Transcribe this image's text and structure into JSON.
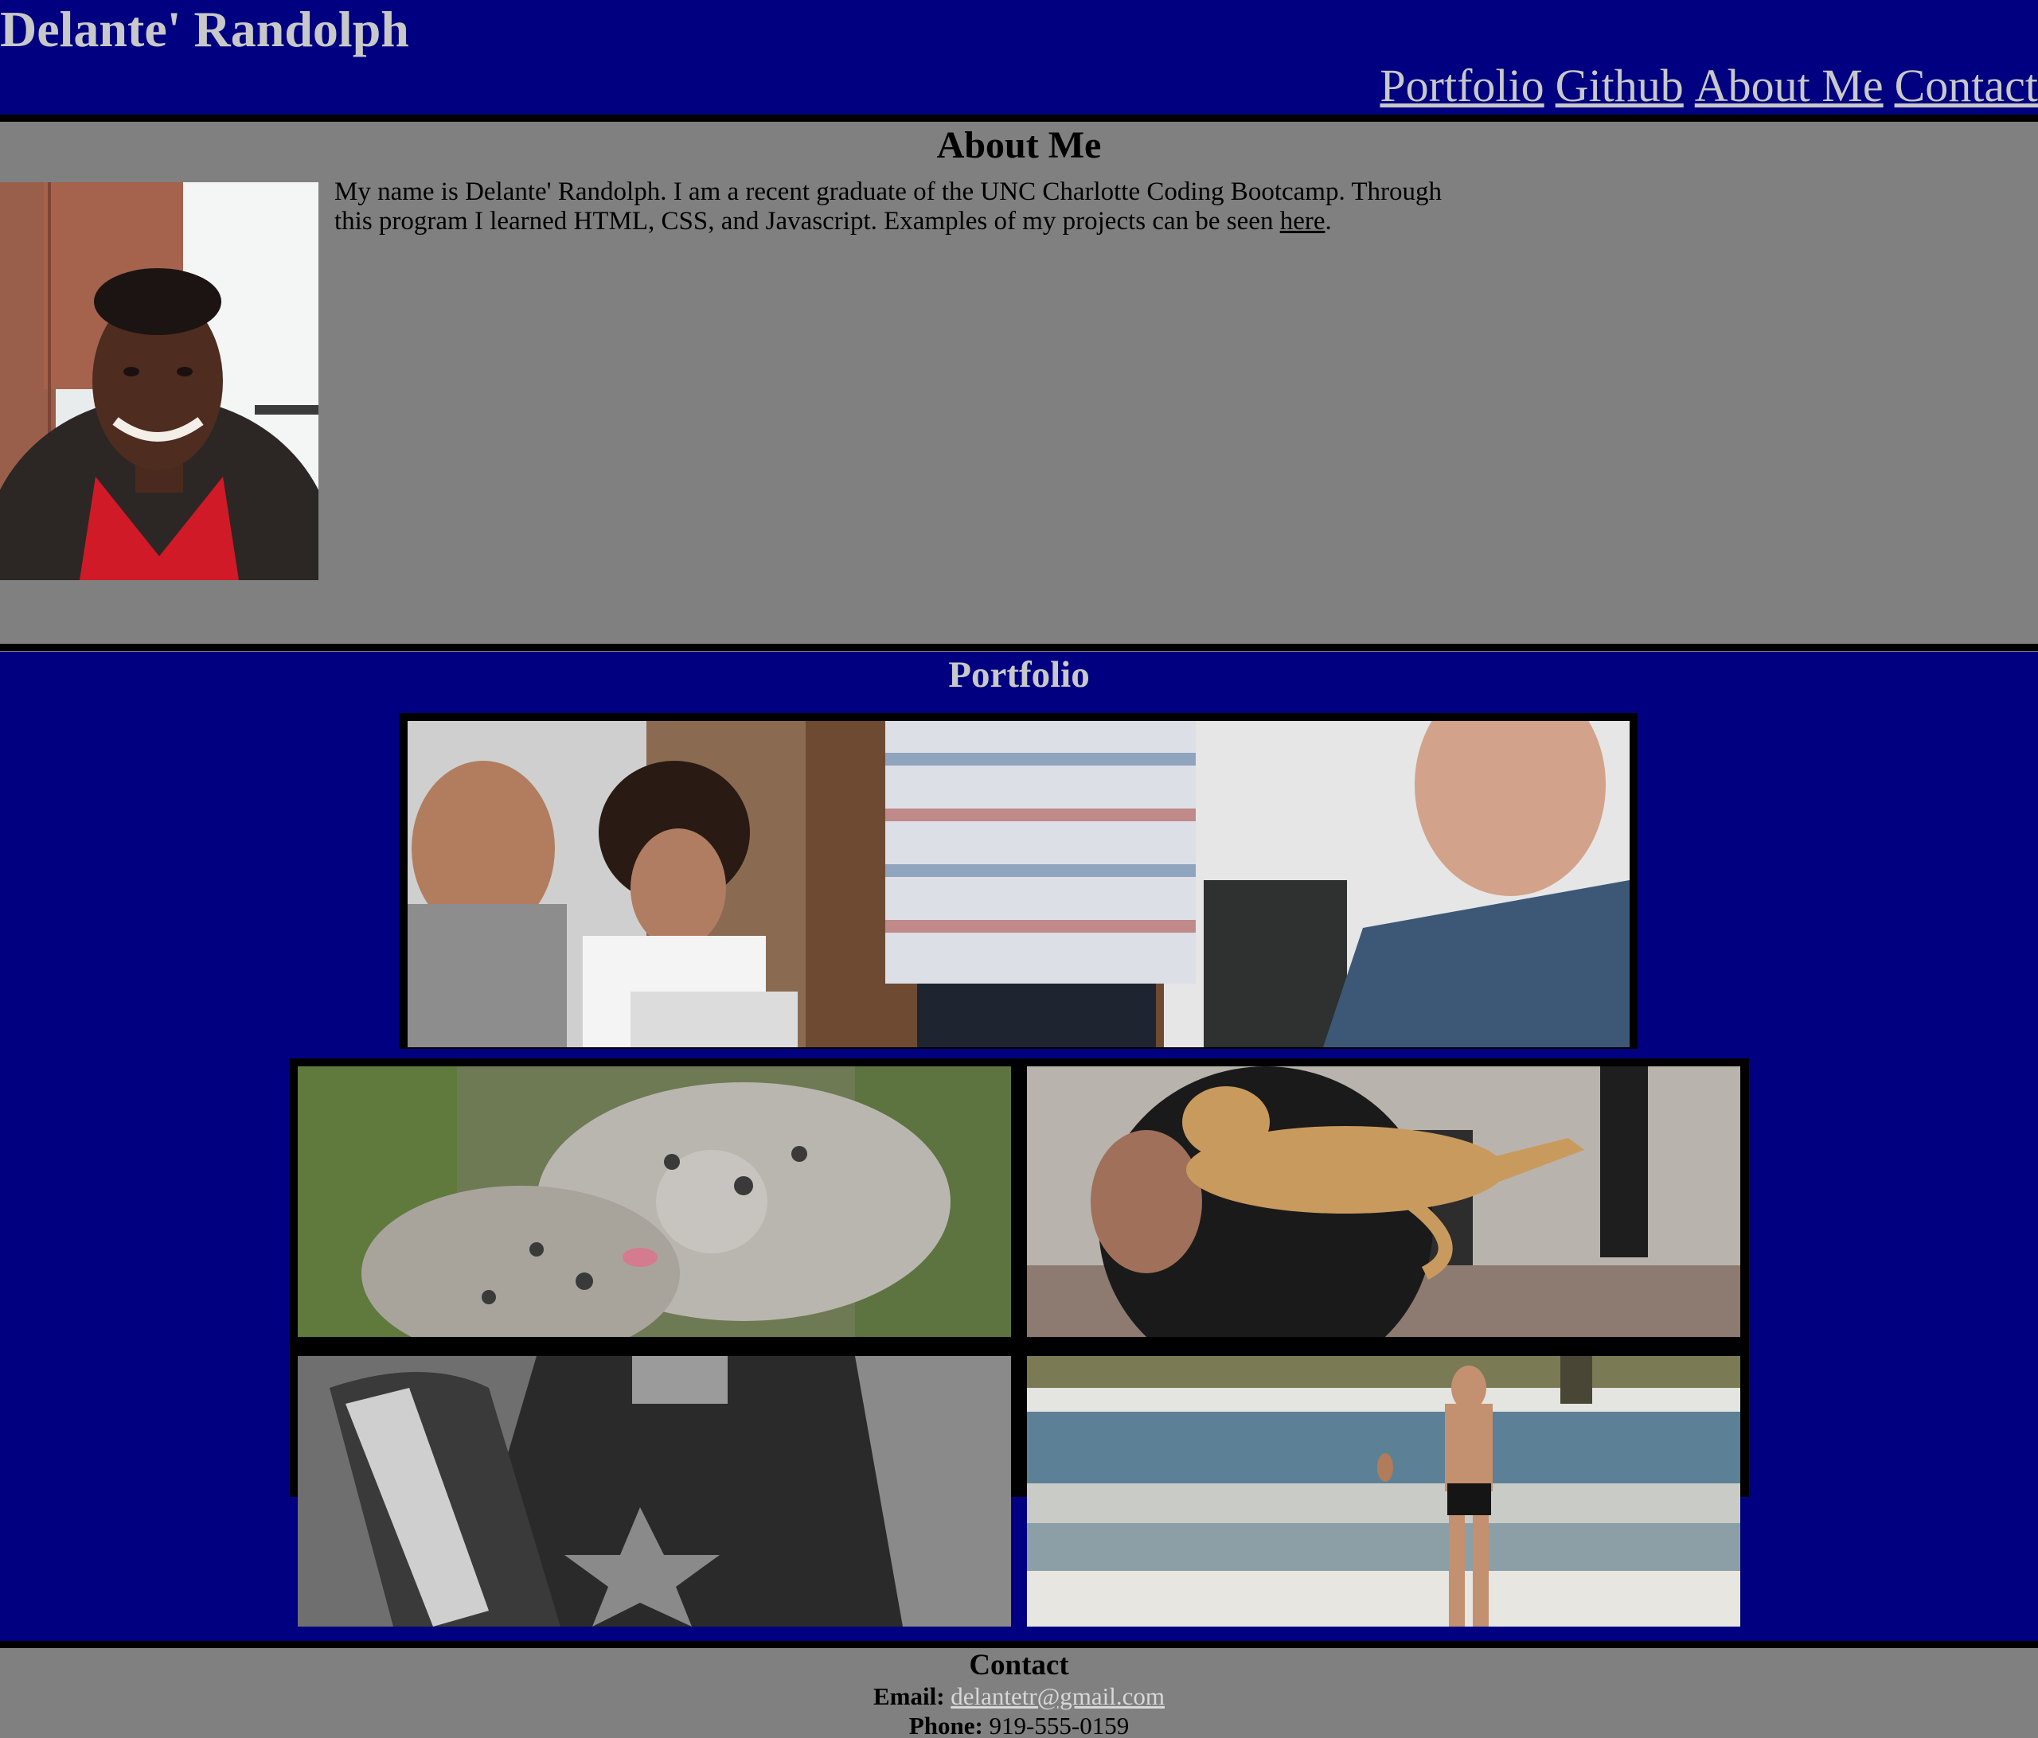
{
  "header": {
    "title": "Delante' Randolph",
    "nav": [
      "Portfolio",
      "Github",
      "About Me",
      "Contact"
    ]
  },
  "about": {
    "heading": "About Me",
    "text_before_link": "My name is Delante' Randolph. I am a recent graduate of the UNC Charlotte Coding Bootcamp. Through this program I learned HTML, CSS, and Javascript. Examples of my projects can be seen ",
    "link_text": "here",
    "text_after_link": "."
  },
  "portfolio": {
    "heading": "Portfolio"
  },
  "contact": {
    "heading": "Contact",
    "email_label": "Email:",
    "email": "delantetr@gmail.com",
    "phone_label": "Phone:",
    "phone": "919-555-0159"
  },
  "colors": {
    "navy": "#000080",
    "gray": "#808080",
    "light_text": "#c8c8c8",
    "divider": "#000000"
  }
}
